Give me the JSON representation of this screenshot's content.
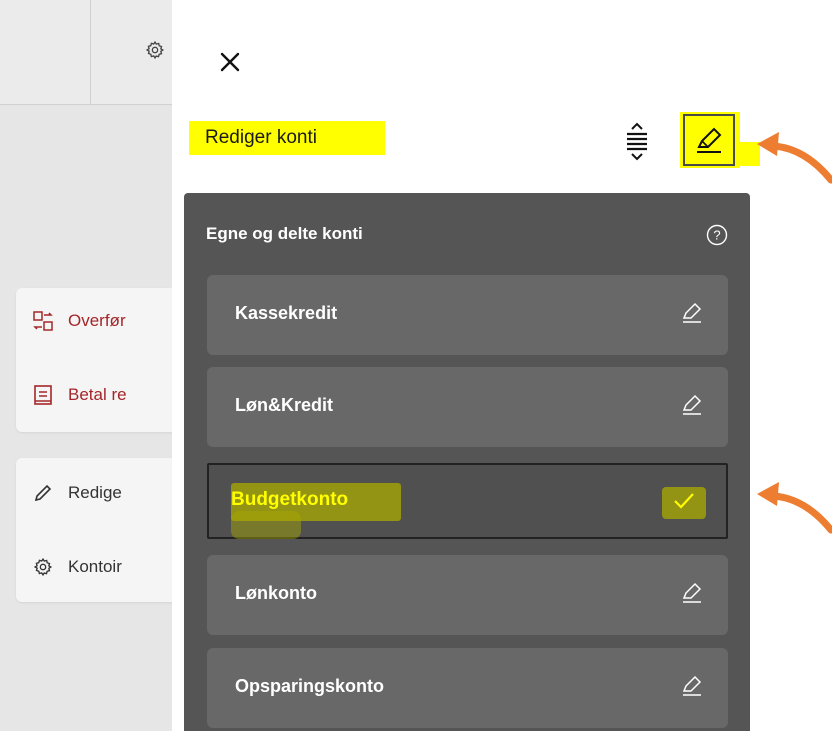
{
  "background": {
    "menu_items": [
      {
        "label": "Overfør",
        "icon": "transfer-icon"
      },
      {
        "label": "Betal re",
        "icon": "bill-icon"
      },
      {
        "label": "Redige",
        "icon": "pencil-icon"
      },
      {
        "label": "Kontoir",
        "icon": "gear-icon"
      }
    ]
  },
  "panel": {
    "title": "Rediger konti",
    "section_header": "Egne og delte konti",
    "accounts": [
      {
        "name": "Kassekredit",
        "state": "edit"
      },
      {
        "name": "Løn&Kredit",
        "state": "edit"
      },
      {
        "name": "Budgetkonto",
        "state": "selected"
      },
      {
        "name": "Lønkonto",
        "state": "edit"
      },
      {
        "name": "Opsparingskonto",
        "state": "edit"
      }
    ]
  },
  "colors": {
    "highlight": "#ffff00",
    "annotation_arrow": "#ed7d31",
    "dropdown_bg": "#555555",
    "account_bg": "#686868",
    "background_link": "#a5262a"
  }
}
